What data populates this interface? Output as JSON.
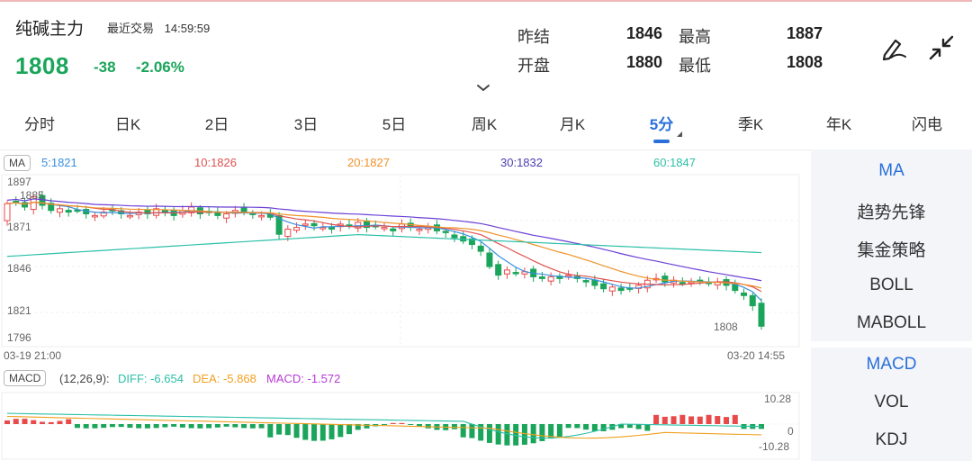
{
  "header": {
    "title": "纯碱主力",
    "status_label": "最近交易",
    "status_time": "14:59:59",
    "price": "1808",
    "change": "-38",
    "change_pct": "-2.06%"
  },
  "stats": {
    "prev_settle_label": "昨结",
    "prev_settle": "1846",
    "high_label": "最高",
    "high": "1887",
    "open_label": "开盘",
    "open": "1880",
    "low_label": "最低",
    "low": "1808"
  },
  "tabs": [
    "分时",
    "日K",
    "2日",
    "3日",
    "5日",
    "周K",
    "月K",
    "5分",
    "季K",
    "年K",
    "闪电"
  ],
  "active_tab": "5分",
  "ma_bar": {
    "badge": "MA",
    "ma5": "5:1821",
    "ma10": "10:1826",
    "ma20": "20:1827",
    "ma30": "30:1832",
    "ma60": "60:1847"
  },
  "price_axis": {
    "top": "1897",
    "max_marker": "1885",
    "l2": "1871",
    "l3": "1846",
    "l4": "1821",
    "bottom": "1796",
    "min_marker": "1808"
  },
  "time_axis": {
    "start": "03-19 21:00",
    "end": "03-20 14:55"
  },
  "macd_bar": {
    "badge": "MACD",
    "params": "(12,26,9):",
    "diff": "DIFF: -6.654",
    "dea": "DEA: -5.868",
    "macd": "MACD: -1.572",
    "axis_top": "10.28",
    "axis_mid": "0",
    "axis_bottom": "-10.28"
  },
  "side_panel": {
    "main_indicators": [
      "MA",
      "趋势先锋",
      "集金策略",
      "BOLL",
      "MABOLL"
    ],
    "sub_indicators": [
      "MACD",
      "VOL",
      "KDJ"
    ]
  },
  "colors": {
    "up": "#e84a4a",
    "down": "#1aa55a",
    "accent": "#2a6fdb",
    "ma5": "#3a8fe0",
    "ma10": "#e05050",
    "ma20": "#f0922a",
    "ma30": "#6a3fd6",
    "ma60": "#2bbfa8"
  },
  "icons": {
    "draw": "pen-draw-icon",
    "collapse": "collapse-arrows-icon",
    "expand": "chevron-down-icon"
  }
}
